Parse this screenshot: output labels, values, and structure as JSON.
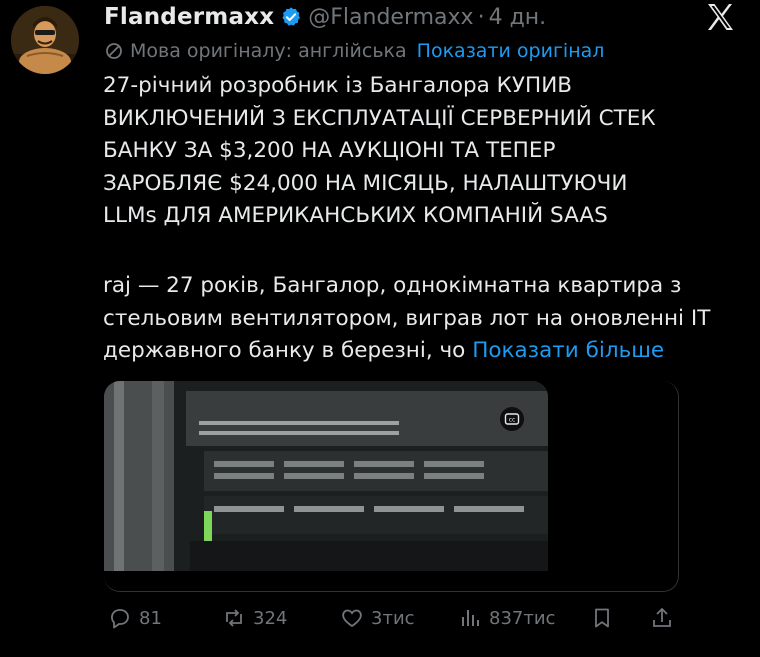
{
  "author": {
    "name": "Flandermaxx",
    "handle": "@Flandermaxx",
    "separator": "·",
    "time": "4 дн."
  },
  "translation": {
    "label": "Мова оригіналу: англійська",
    "show_original": "Показати оригінал"
  },
  "post": {
    "headline": "27-річний розробник із Бангалора КУПИВ\nВИКЛЮЧЕНИЙ З ЕКСПЛУАТАЦІЇ СЕРВЕРНИЙ СТЕК\nБАНКУ ЗА $3,200 НА АУКЦІОНІ ТА ТЕПЕР\nЗАРОБЛЯЄ $24,000 НА МІСЯЦЬ, НАЛАШТУЮЧИ\nLLMs ДЛЯ АМЕРИКАНСЬКИХ КОМПАНІЙ SAAS",
    "body": "raj — 27 років, Бангалор, однокімнатна квартира з стельовим вентилятором, виграв лот на оновленні IT державного банку в березні, чо ",
    "show_more": "Показати більше"
  },
  "media": {
    "cc_label": "cc"
  },
  "actions": {
    "replies": "81",
    "reposts": "324",
    "likes": "3тис",
    "views": "837тис"
  },
  "colors": {
    "background": "#000000",
    "text": "#e7e9ea",
    "secondary": "#71767b",
    "link": "#1d9bf0",
    "verified": "#1d9bf0"
  },
  "icons": [
    "verified-badge-icon",
    "x-logo-icon",
    "translate-icon",
    "closed-captions-icon",
    "reply-icon",
    "repost-icon",
    "like-icon",
    "views-icon",
    "bookmark-icon",
    "share-icon"
  ]
}
